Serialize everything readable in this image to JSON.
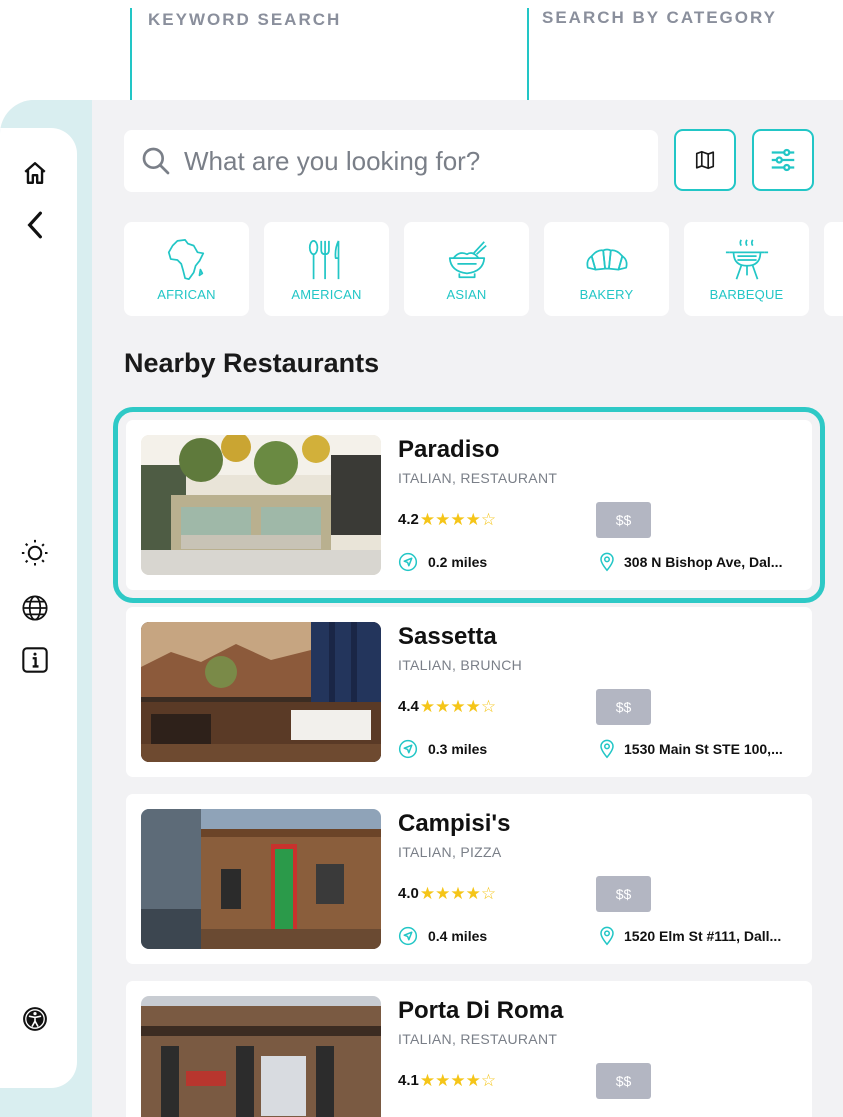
{
  "annotations": {
    "keyword": "KEYWORD SEARCH",
    "category": "SEARCH BY CATEGORY"
  },
  "rail": {
    "top_icons": [
      "home-icon",
      "back-icon"
    ],
    "middle_icons": [
      "brightness-icon",
      "globe-icon",
      "info-icon"
    ],
    "bottom_icons": [
      "accessibility-icon"
    ]
  },
  "search": {
    "placeholder": "What are you looking for?"
  },
  "toolbar": {
    "map_icon": "map-icon",
    "filter_icon": "filter-sliders-icon"
  },
  "categories": [
    {
      "label": "AFRICAN",
      "icon": "africa-icon"
    },
    {
      "label": "AMERICAN",
      "icon": "utensils-icon"
    },
    {
      "label": "ASIAN",
      "icon": "bowl-chopsticks-icon"
    },
    {
      "label": "BAKERY",
      "icon": "croissant-icon"
    },
    {
      "label": "BARBEQUE",
      "icon": "grill-icon"
    }
  ],
  "section_title": "Nearby Restaurants",
  "restaurants": [
    {
      "name": "Paradiso",
      "tags": "ITALIAN, RESTAURANT",
      "rating": "4.2",
      "rating_value": 4.2,
      "price": "$$",
      "distance": "0.2 miles",
      "address": "308 N Bishop Ave, Dal..."
    },
    {
      "name": "Sassetta",
      "tags": "ITALIAN, BRUNCH",
      "rating": "4.4",
      "rating_value": 4.4,
      "price": "$$",
      "distance": "0.3 miles",
      "address": "1530 Main St STE 100,..."
    },
    {
      "name": "Campisi's",
      "tags": "ITALIAN, PIZZA",
      "rating": "4.0",
      "rating_value": 4.0,
      "price": "$$",
      "distance": "0.4 miles",
      "address": "1520 Elm St #111, Dall..."
    },
    {
      "name": "Porta Di Roma",
      "tags": "ITALIAN, RESTAURANT",
      "rating": "4.1",
      "rating_value": 4.1,
      "price": "$$",
      "distance": "",
      "address": ""
    }
  ],
  "colors": {
    "accent": "#22c6c6",
    "star": "#f5c518",
    "price_badge": "#b3b6c2",
    "rail_tint": "#d9eef0"
  }
}
